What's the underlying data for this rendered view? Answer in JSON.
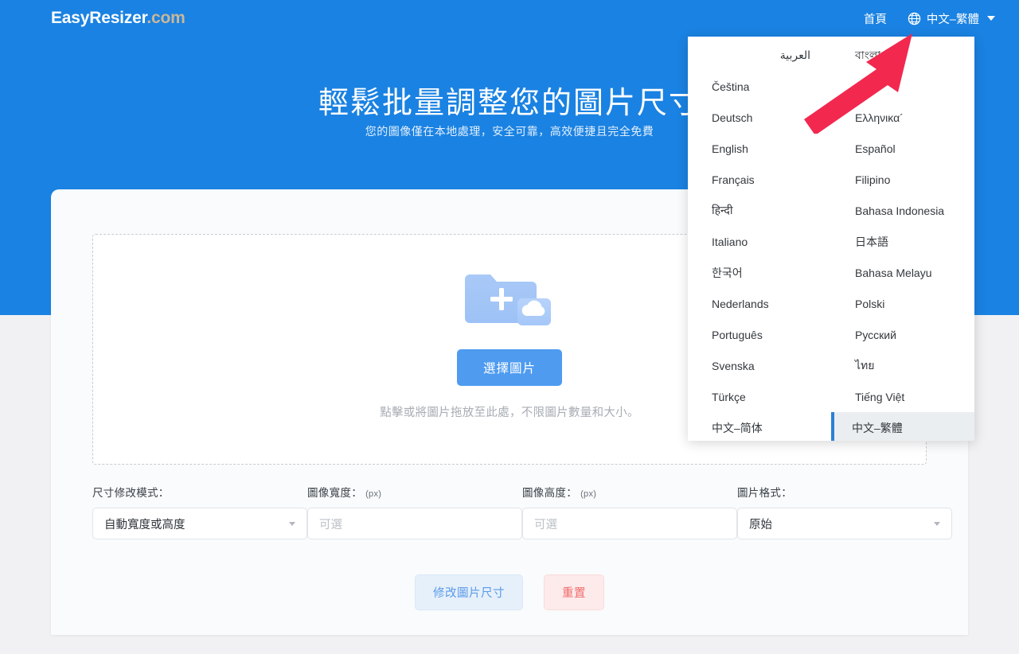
{
  "header": {
    "logo_main": "EasyResizer",
    "logo_suffix": ".com",
    "nav_home": "首頁",
    "globe_icon": "globe-icon",
    "current_language": "中文–繁體",
    "chevron_icon": "chevron-down-icon"
  },
  "hero": {
    "title": "輕鬆批量調整您的圖片尺寸",
    "subtitle": "您的圖像僅在本地處理，安全可靠，高效便捷且完全免費"
  },
  "uploader": {
    "icon": "folder-plus-cloud-icon",
    "select_button": "選擇圖片",
    "hint": "點擊或將圖片拖放至此處，不限圖片數量和大小。"
  },
  "options": [
    {
      "label": "尺寸修改模式：",
      "unit": "",
      "type": "select",
      "value": "自動寬度或高度",
      "name": "resize-mode"
    },
    {
      "label": "圖像寬度：",
      "unit": "(px)",
      "type": "input",
      "value": "",
      "placeholder": "可選",
      "name": "image-width"
    },
    {
      "label": "圖像高度：",
      "unit": "(px)",
      "type": "input",
      "value": "",
      "placeholder": "可選",
      "name": "image-height"
    },
    {
      "label": "圖片格式：",
      "unit": "",
      "type": "select",
      "value": "原始",
      "name": "image-format"
    }
  ],
  "actions": {
    "resize": "修改圖片尺寸",
    "reset": "重置"
  },
  "language_menu": {
    "selected": "中文–繁體",
    "items": [
      {
        "label": "العربية",
        "rtl": true
      },
      {
        "label": "বাংলা",
        "rtl": false
      },
      {
        "label": "Čeština",
        "rtl": false
      },
      {
        "label": "",
        "rtl": false,
        "obscured": true
      },
      {
        "label": "Deutsch",
        "rtl": false
      },
      {
        "label": "Ελληνικα´",
        "rtl": false
      },
      {
        "label": "English",
        "rtl": false
      },
      {
        "label": "Español",
        "rtl": false
      },
      {
        "label": "Français",
        "rtl": false
      },
      {
        "label": "Filipino",
        "rtl": false
      },
      {
        "label": "हिन्दी",
        "rtl": false
      },
      {
        "label": "Bahasa Indonesia",
        "rtl": false
      },
      {
        "label": "Italiano",
        "rtl": false
      },
      {
        "label": "日本語",
        "rtl": false
      },
      {
        "label": "한국어",
        "rtl": false
      },
      {
        "label": "Bahasa Melayu",
        "rtl": false
      },
      {
        "label": "Nederlands",
        "rtl": false
      },
      {
        "label": "Polski",
        "rtl": false
      },
      {
        "label": "Português",
        "rtl": false
      },
      {
        "label": "Русский",
        "rtl": false
      },
      {
        "label": "Svenska",
        "rtl": false
      },
      {
        "label": "ไทย",
        "rtl": false
      },
      {
        "label": "Türkçe",
        "rtl": false
      },
      {
        "label": "Tiếng Việt",
        "rtl": false
      },
      {
        "label": "中文–简体",
        "rtl": false
      },
      {
        "label": "中文–繁體",
        "rtl": false
      }
    ]
  },
  "annotation": {
    "arrow_icon": "red-arrow-pointer",
    "arrow_color": "#f2284f"
  },
  "colors": {
    "hero_blue": "#1a82e2",
    "button_blue": "#4e9bf0",
    "accent_red": "#f2284f",
    "selected_bg": "#ebeef0",
    "selected_border": "#2d7fd6"
  }
}
